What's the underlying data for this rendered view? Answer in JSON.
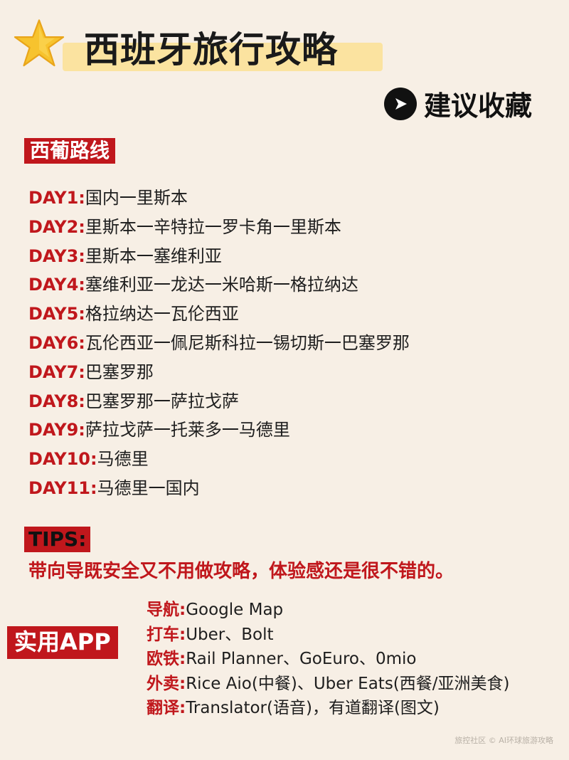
{
  "title": "西班牙旅行攻略",
  "icons": {
    "star": "star-emoji-icon",
    "collect": "play-arrow-icon"
  },
  "colors": {
    "background": "#f7efe5",
    "accent_red": "#c0171c",
    "title_highlight": "#fbe3a0",
    "star": "#f7c32e"
  },
  "collect_label": "建议收藏",
  "route": {
    "heading": "西葡路线",
    "days": [
      {
        "label": "DAY1:",
        "route": "国内一里斯本"
      },
      {
        "label": "DAY2:",
        "route": "里斯本一辛特拉一罗卡角一里斯本"
      },
      {
        "label": "DAY3:",
        "route": "里斯本一塞维利亚"
      },
      {
        "label": "DAY4:",
        "route": "塞维利亚一龙达一米哈斯一格拉纳达"
      },
      {
        "label": "DAY5:",
        "route": "格拉纳达一瓦伦西亚"
      },
      {
        "label": "DAY6:",
        "route": "瓦伦西亚一佩尼斯科拉一锡切斯一巴塞罗那"
      },
      {
        "label": "DAY7:",
        "route": "巴塞罗那"
      },
      {
        "label": "DAY8:",
        "route": "巴塞罗那一萨拉戈萨"
      },
      {
        "label": "DAY9:",
        "route": "萨拉戈萨一托莱多一马德里"
      },
      {
        "label": "DAY10:",
        "route": "马德里"
      },
      {
        "label": "DAY11:",
        "route": "马德里一国内"
      }
    ]
  },
  "tips": {
    "heading": "TIPS:",
    "text": "带向导既安全又不用做攻略，体验感还是很不错的。"
  },
  "apps": {
    "heading": "实用APP",
    "items": [
      {
        "label": "导航:",
        "value": "Google Map"
      },
      {
        "label": "打车:",
        "value": "Uber、Bolt"
      },
      {
        "label": "欧铁:",
        "value": "Rail Planner、GoEuro、0mio"
      },
      {
        "label": "外卖:",
        "value": "Rice Aio(中餐)、Uber Eats(西餐/亚洲美食)"
      },
      {
        "label": "翻译:",
        "value": "Translator(语音)，有道翻译(图文)"
      }
    ]
  },
  "watermark": "旅控社区 © AI环球旅游攻略"
}
